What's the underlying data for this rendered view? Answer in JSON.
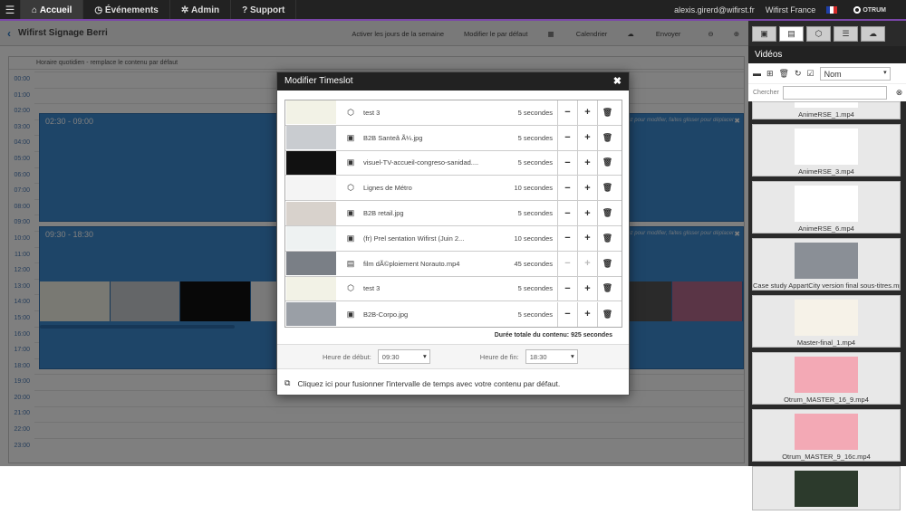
{
  "nav": {
    "menu_icon": "hamburger-icon",
    "tabs": [
      {
        "label": "Accueil",
        "icon": "home-icon",
        "glyph": "⌂"
      },
      {
        "label": "Événements",
        "icon": "clock-icon",
        "glyph": "◷"
      },
      {
        "label": "Admin",
        "icon": "gears-icon",
        "glyph": "✲"
      },
      {
        "label": "Support",
        "icon": "help-icon",
        "glyph": "?"
      }
    ],
    "user_email": "alexis.girerd@wifirst.fr",
    "org": "Wifirst France",
    "logo_text": "OTRUM"
  },
  "appbar": {
    "back_glyph": "‹",
    "title": "Wifirst Signage Berri",
    "actions": [
      "Activer les jours de la semaine",
      "Modifier le par défaut",
      "Calendrier",
      "Envoyer"
    ]
  },
  "schedule": {
    "header": "Horaire quotidien - remplace le contenu par défaut",
    "times": [
      "00:00",
      "01:00",
      "02:00",
      "03:00",
      "04:00",
      "05:00",
      "06:00",
      "07:00",
      "08:00",
      "09:00",
      "10:00",
      "11:00",
      "12:00",
      "13:00",
      "14:00",
      "15:00",
      "16:00",
      "17:00",
      "18:00",
      "19:00",
      "20:00",
      "21:00",
      "22:00",
      "23:00"
    ],
    "blocks": [
      {
        "label": "02:30 - 09:00",
        "note": "Cliquez pour modifier, faites glisser pour déplacer"
      },
      {
        "label": "09:30 - 18:30",
        "note": "Cliquez pour modifier, faites glisser pour déplacer"
      }
    ]
  },
  "sidebar": {
    "tabs": [
      "image-tab-icon",
      "video-tab-icon",
      "cube-tab-icon",
      "list-tab-icon",
      "cloud-tab-icon"
    ],
    "title": "Vidéos",
    "sort_placeholder": "Nom",
    "search_label": "Chercher",
    "videos": [
      {
        "name": "AnimeRSE_1.mp4",
        "thumb": "#ffffff"
      },
      {
        "name": "AnimeRSE_3.mp4",
        "thumb": "#ffffff"
      },
      {
        "name": "AnimeRSE_6.mp4",
        "thumb": "#ffffff"
      },
      {
        "name": "Case study AppartCity version final sous-titres.mp4",
        "thumb": "#8a8f96"
      },
      {
        "name": "Master-final_1.mp4",
        "thumb": "#f6f2e8"
      },
      {
        "name": "Otrum_MASTER_16_9.mp4",
        "thumb": "#f3a9b5"
      },
      {
        "name": "Otrum_MASTER_9_16c.mp4",
        "thumb": "#f3a9b5"
      },
      {
        "name": "",
        "thumb": "#2c3a2c"
      }
    ]
  },
  "modal": {
    "title": "Modifier Timeslot",
    "close_glyph": "✖",
    "items": [
      {
        "name": "test 3",
        "type": "cube-icon",
        "type_glyph": "⬡",
        "duration": "5 secondes",
        "thumb": "#f2f2e6",
        "first": true,
        "last": false
      },
      {
        "name": "B2B Santeâ      Ã¼.jpg",
        "type": "image-icon",
        "type_glyph": "▣",
        "duration": "5 secondes",
        "thumb": "#c9ccd0",
        "first": false,
        "last": false
      },
      {
        "name": "visuel-TV-accueil-congreso-sanidad....",
        "type": "image-icon",
        "type_glyph": "▣",
        "duration": "5 secondes",
        "thumb": "#111111",
        "first": false,
        "last": false
      },
      {
        "name": "Lignes de Métro",
        "type": "cube-icon",
        "type_glyph": "⬡",
        "duration": "10 secondes",
        "thumb": "#f4f4f4",
        "first": false,
        "last": false
      },
      {
        "name": "B2B retail.jpg",
        "type": "image-icon",
        "type_glyph": "▣",
        "duration": "5 secondes",
        "thumb": "#d8d2cc",
        "first": false,
        "last": false
      },
      {
        "name": "(fr) Prel    sentation Wifirst (Juin 2...",
        "type": "image-icon",
        "type_glyph": "▣",
        "duration": "10 secondes",
        "thumb": "#eef2f2",
        "first": false,
        "last": false
      },
      {
        "name": "film dÃ©ploiement Norauto.mp4",
        "type": "video-icon",
        "type_glyph": "▤",
        "duration": "45 secondes",
        "thumb": "#7a7f86",
        "first": false,
        "last": false
      },
      {
        "name": "test 3",
        "type": "cube-icon",
        "type_glyph": "⬡",
        "duration": "5 secondes",
        "thumb": "#f2f2e6",
        "first": false,
        "last": false
      },
      {
        "name": "B2B-Corpo.jpg",
        "type": "image-icon",
        "type_glyph": "▣",
        "duration": "5 secondes",
        "thumb": "#9a9fa6",
        "first": false,
        "last": true
      }
    ],
    "total_label": "Durée totale du contenu: 925 secondes",
    "start_label": "Heure de début:",
    "start_value": "09:30",
    "end_label": "Heure de fin:",
    "end_value": "18:30",
    "merge_text": "Cliquez ici pour fusionner l'intervalle de temps avec votre contenu par défaut."
  },
  "colors": {
    "accent": "#3d8bd0",
    "nav_bg": "#222222",
    "purple_bar": "#7a46a8"
  }
}
